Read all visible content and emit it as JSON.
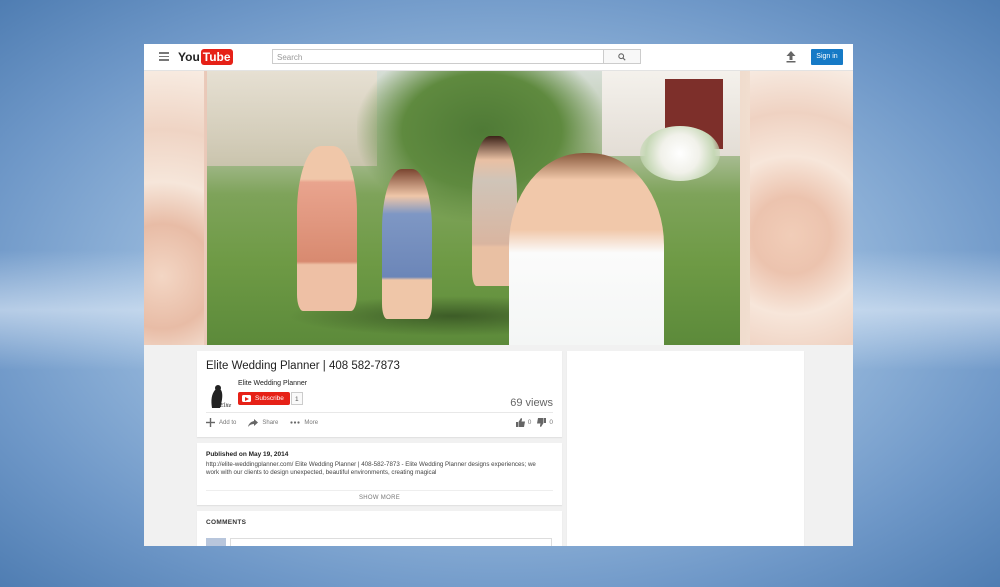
{
  "masthead": {
    "logo_you": "You",
    "logo_tube": "Tube",
    "search_placeholder": "Search",
    "signin_label": "Sign in"
  },
  "video": {
    "title": "Elite Wedding Planner | 408 582-7873",
    "channel_name": "Elite Wedding Planner",
    "subscribe_label": "Subscribe",
    "subscriber_count": "1",
    "views": "69 views",
    "actions": {
      "add_to": "Add to",
      "share": "Share",
      "more": "More"
    },
    "likes": "0",
    "dislikes": "0"
  },
  "description": {
    "published": "Published on May 19, 2014",
    "text": "http://elite-weddingplanner.com/ Elite Wedding Planner | 408-582-7873 - Elite Wedding Planner designs experiences; we work with our clients to design unexpected, beautiful environments, creating magical",
    "show_more": "SHOW MORE"
  },
  "comments": {
    "heading": "COMMENTS"
  },
  "colors": {
    "youtube_red": "#e62117",
    "signin_blue": "#167ac6"
  }
}
